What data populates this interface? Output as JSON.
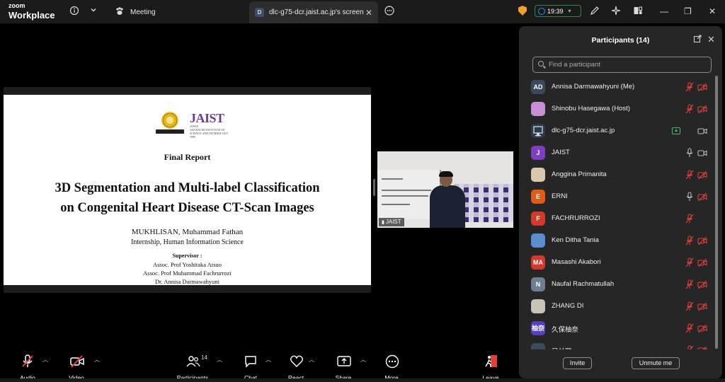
{
  "titlebar": {
    "brand_top": "zoom",
    "brand_bottom": "Workplace",
    "meeting_tab": "Meeting",
    "screen_tab": "dlc-g75-dcr.jaist.ac.jp's screen",
    "screen_tab_badge": "D",
    "timer": "19:39",
    "icons": [
      "info-icon",
      "chevron-down-icon",
      "meeting-paw-icon",
      "more-icon",
      "shield-icon",
      "clock-icon",
      "annotate-icon",
      "sparkle-icon",
      "view-icon",
      "minimize-icon",
      "restore-icon",
      "close-icon"
    ]
  },
  "slide": {
    "logo_text": "JAIST",
    "logo_sub": [
      "Japan",
      "Advanced Institute of",
      "Science and Technology",
      "1990"
    ],
    "heading": "Final Report",
    "title_line1": "3D Segmentation and Multi-label Classification",
    "title_line2": "on Congenital Heart Disease CT-Scan Images",
    "author": "MUKHLISAN, Muhammad Fathan",
    "program": "Internship, Human Information Science",
    "supervisor_heading": "Supervisor :",
    "supervisors": [
      "Assoc. Prof Yoshitaka Atsuo",
      "Assoc. Prof Muhammad Fachrurrozi",
      "Dr. Annisa Darmawahyuni"
    ]
  },
  "video": {
    "label": "JAIST"
  },
  "panel": {
    "title": "Participants (14)",
    "search_placeholder": "Find a participant",
    "invite_label": "Invite",
    "unmute_label": "Unmute me",
    "participants": [
      {
        "name": "Annisa Darmawahyuni (Me)",
        "initials": "AD",
        "color": "#3b4a5e",
        "mic": "muted",
        "cam": "off"
      },
      {
        "name": "Shinobu Hasegawa (Host)",
        "initials": "",
        "color": "#c98fd6",
        "mic": "muted",
        "cam": "off"
      },
      {
        "name": "dlc-g75-dcr.jaist.ac.jp",
        "initials": "",
        "color": "#2f3b4a",
        "mic": "none",
        "cam": "on",
        "sharing": true
      },
      {
        "name": "JAIST",
        "initials": "J",
        "color": "#7b3fc0",
        "mic": "on",
        "cam": "on"
      },
      {
        "name": "Anggina Primanita",
        "initials": "",
        "color": "#d9c7b0",
        "mic": "muted",
        "cam": "off"
      },
      {
        "name": "ERNI",
        "initials": "E",
        "color": "#e05a1a",
        "mic": "on",
        "cam": "off"
      },
      {
        "name": "FACHRURROZI",
        "initials": "F",
        "color": "#d33a2c",
        "mic": "muted",
        "cam": "none"
      },
      {
        "name": "Ken Ditha Tania",
        "initials": "",
        "color": "#5a8ecf",
        "mic": "muted",
        "cam": "off"
      },
      {
        "name": "Masashi Akabori",
        "initials": "MA",
        "color": "#d33a2c",
        "mic": "muted",
        "cam": "off"
      },
      {
        "name": "Naufal Rachmatullah",
        "initials": "N",
        "color": "#6d7f91",
        "mic": "muted",
        "cam": "off"
      },
      {
        "name": "ZHANG DI",
        "initials": "",
        "color": "#c9c3b5",
        "mic": "muted",
        "cam": "off"
      },
      {
        "name": "久保柚奈",
        "initials": "柚奈",
        "color": "#5a3fc0",
        "mic": "muted",
        "cam": "off"
      },
      {
        "name": "吴林璐",
        "initials": "",
        "color": "#3b4a5e",
        "mic": "muted",
        "cam": "off"
      }
    ]
  },
  "toolbar": {
    "audio": "Audio",
    "video": "Video",
    "participants": "Participants",
    "participants_count": "14",
    "chat": "Chat",
    "react": "React",
    "share": "Share",
    "more": "More",
    "leave": "Leave"
  }
}
